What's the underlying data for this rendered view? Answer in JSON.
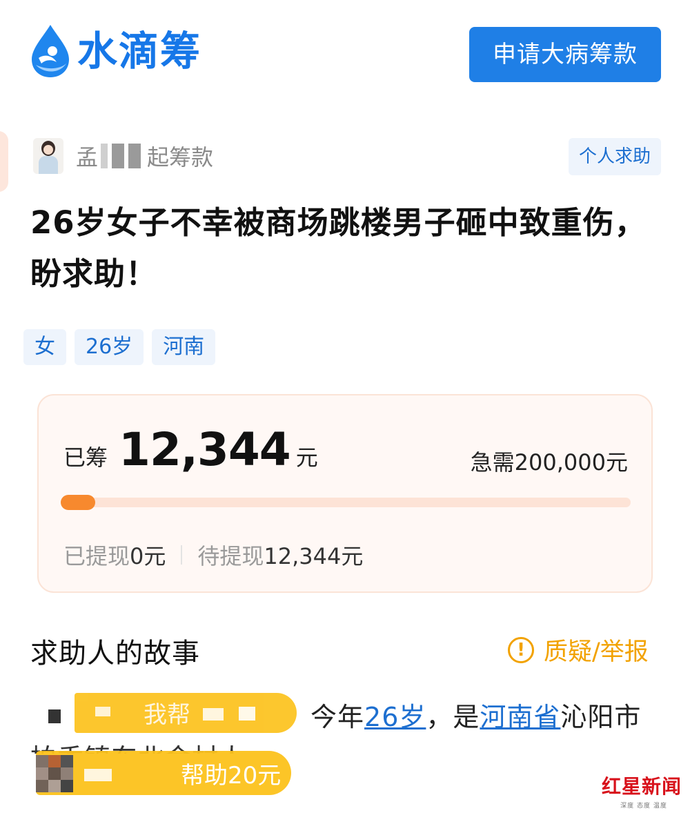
{
  "header": {
    "logo_text": "水滴筹",
    "apply_button": "申请大病筹款"
  },
  "initiator": {
    "name": "孟",
    "suffix": "起筹款",
    "type_badge": "个人求助"
  },
  "campaign": {
    "title": "26岁女子不幸被商场跳楼男子砸中致重伤，盼求助！",
    "tags": [
      "女",
      "26岁",
      "河南"
    ]
  },
  "funding": {
    "raised_label": "已筹",
    "raised_amount": "12,344",
    "raised_unit": "元",
    "target": "急需200,000元",
    "progress_fraction": 0.06,
    "withdrawn_label": "已提现",
    "withdrawn_amount": "0元",
    "pending_label": "待提现",
    "pending_amount": "12,344元"
  },
  "story": {
    "title": "求助人的故事",
    "report_label": "质疑/举报",
    "line1_prefix": "今年",
    "line1_age": "26岁",
    "line1_mid": "，是",
    "line1_province": "河南省",
    "line1_suffix": "沁阳市",
    "line2": "柏香镇东北金村人。"
  },
  "popups": {
    "popup1_text": "我帮",
    "popup2_text": "帮助20元"
  },
  "watermark": {
    "main": "红星新闻",
    "sub": "深度 态度 温度"
  },
  "colors": {
    "brand_blue": "#1f7fe6",
    "progress_orange": "#f7892e",
    "report_yellow": "#f2a200",
    "popup_yellow": "#fcc21c"
  }
}
